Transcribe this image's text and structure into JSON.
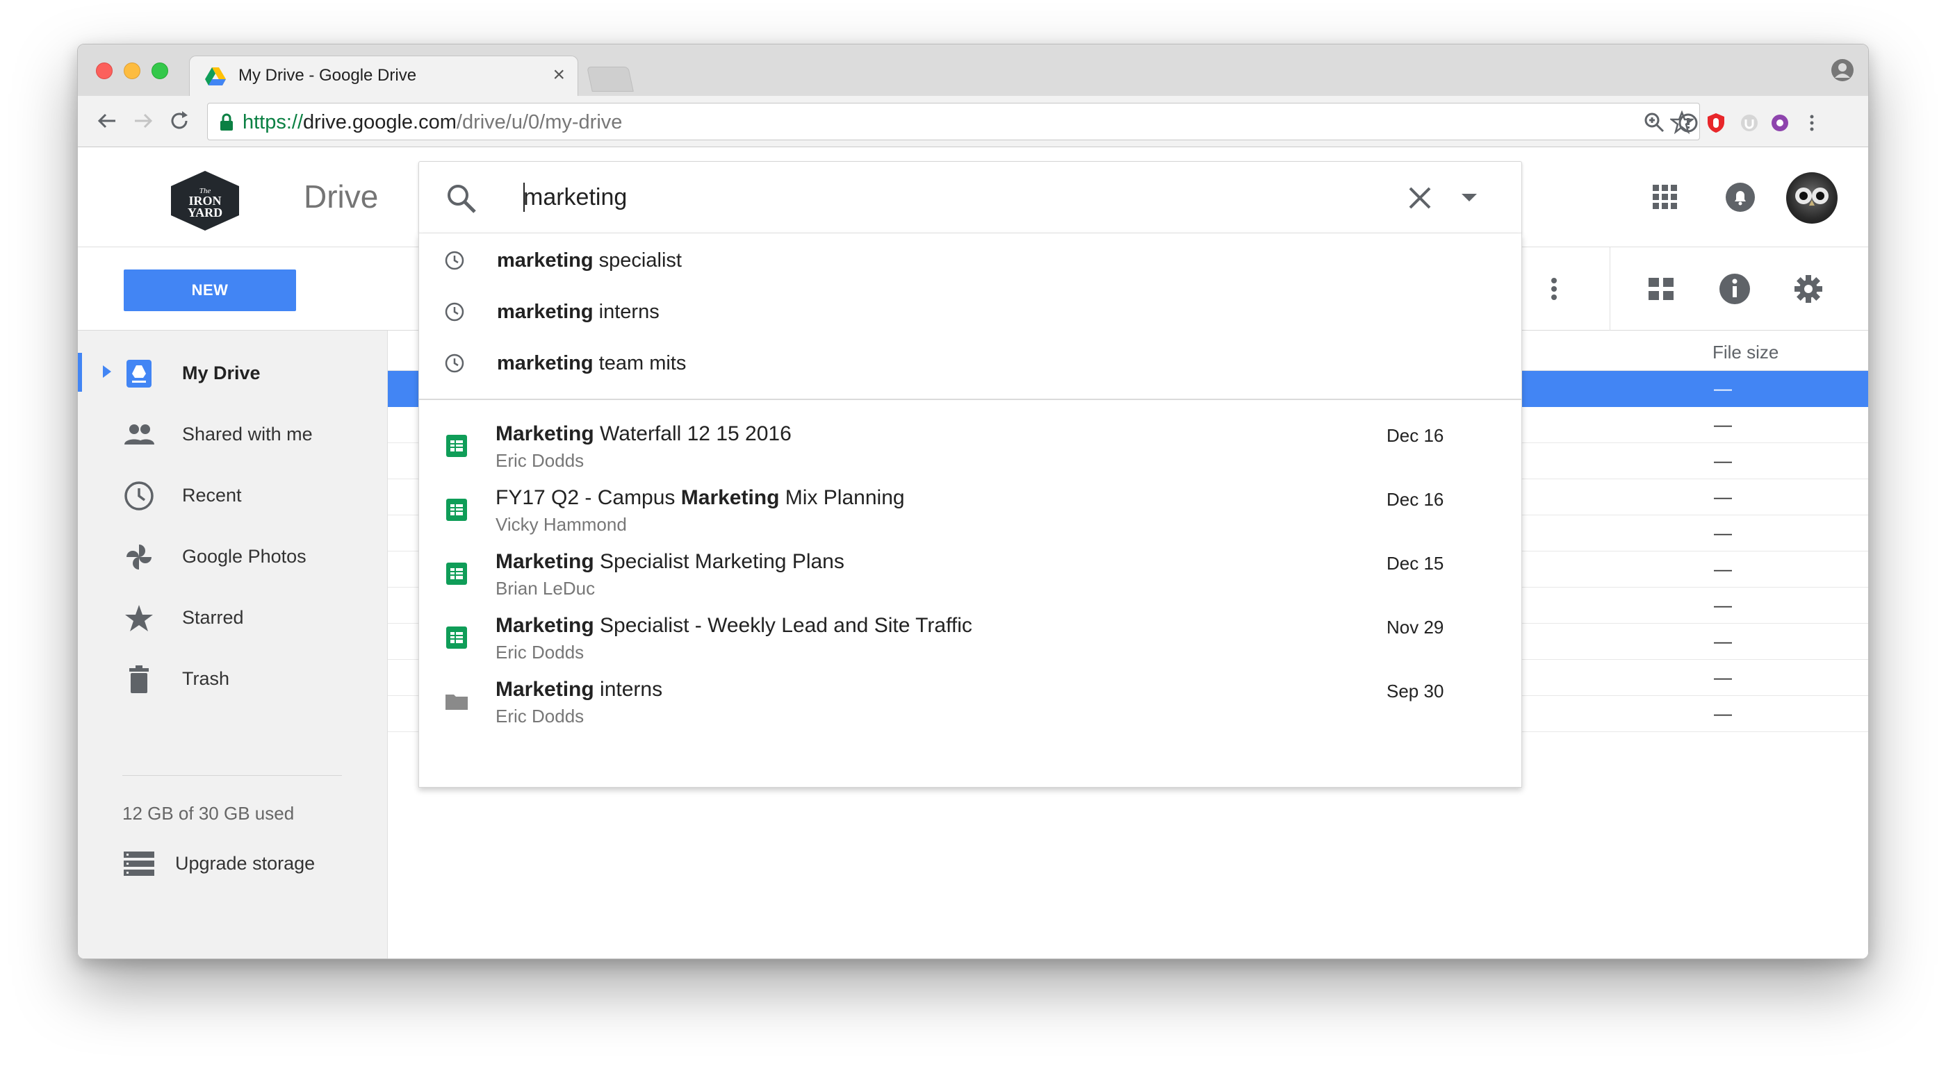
{
  "browser": {
    "tab_title": "My Drive - Google Drive",
    "tab_close": "×",
    "url_scheme": "https://",
    "url_host": "drive.google.com",
    "url_path": "/drive/u/0/my-drive"
  },
  "header": {
    "logo_text": "The Iron Yard",
    "app_name": "Drive"
  },
  "search": {
    "query": "marketing",
    "history": [
      {
        "bold": "marketing",
        "rest": " specialist"
      },
      {
        "bold": "marketing",
        "rest": " interns"
      },
      {
        "bold": "marketing",
        "rest": " team mits"
      }
    ],
    "results": [
      {
        "pre": "",
        "bold": "Marketing",
        "post": " Waterfall 12 15 2016",
        "owner": "Eric Dodds",
        "date": "Dec 16",
        "type": "sheet"
      },
      {
        "pre": "FY17 Q2 - Campus ",
        "bold": "Marketing",
        "post": " Mix Planning",
        "owner": "Vicky Hammond",
        "date": "Dec 16",
        "type": "sheet"
      },
      {
        "pre": "",
        "bold": "Marketing",
        "post": " Specialist Marketing Plans",
        "owner": "Brian LeDuc",
        "date": "Dec 15",
        "type": "sheet"
      },
      {
        "pre": "",
        "bold": "Marketing",
        "post": " Specialist - Weekly Lead and Site Traffic",
        "owner": "Eric Dodds",
        "date": "Nov 29",
        "type": "sheet"
      },
      {
        "pre": "",
        "bold": "Marketing",
        "post": " interns",
        "owner": "Eric Dodds",
        "date": "Sep 30",
        "type": "folder"
      }
    ]
  },
  "toolbar": {
    "new_label": "NEW"
  },
  "sidebar": {
    "items": [
      {
        "label": "My Drive"
      },
      {
        "label": "Shared with me"
      },
      {
        "label": "Recent"
      },
      {
        "label": "Google Photos"
      },
      {
        "label": "Starred"
      },
      {
        "label": "Trash"
      }
    ],
    "storage_text": "12 GB of 30 GB used",
    "upgrade_label": "Upgrade storage"
  },
  "file_list": {
    "col_file_size": "File size",
    "rows": [
      "—",
      "—",
      "—",
      "—",
      "—",
      "—",
      "—",
      "—",
      "—",
      "—"
    ]
  },
  "colors": {
    "accent": "#4285f4",
    "sheets_green": "#0f9d58"
  }
}
